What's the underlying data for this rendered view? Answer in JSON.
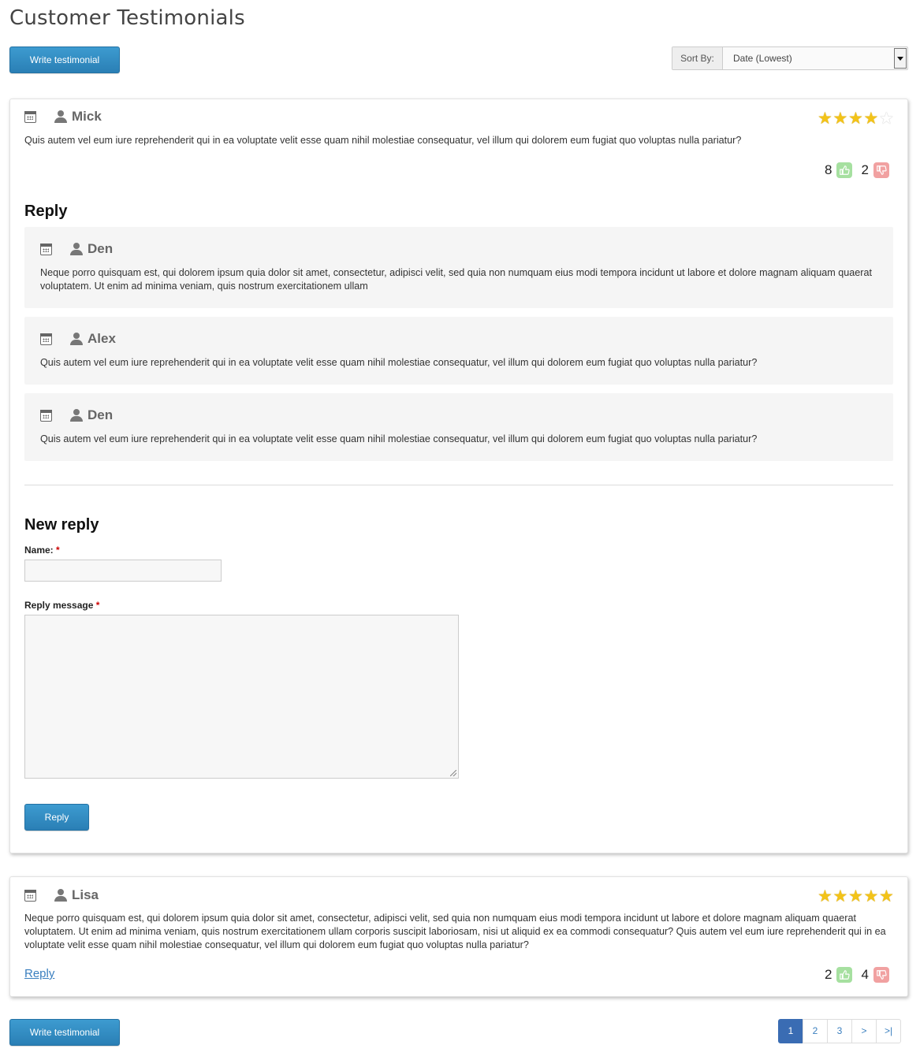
{
  "page": {
    "title": "Customer Testimonials"
  },
  "toolbar": {
    "write_label": "Write testimonial",
    "sort_label": "Sort By:",
    "sort_value": "Date (Lowest)"
  },
  "testimonials": [
    {
      "author": "Mick",
      "rating": 4,
      "text": "Quis autem vel eum iure reprehenderit qui in ea voluptate velit esse quam nihil molestiae consequatur, vel illum qui dolorem eum fugiat quo voluptas nulla pariatur?",
      "likes": "8",
      "dislikes": "2",
      "reply_heading": "Reply",
      "replies": [
        {
          "author": "Den",
          "text": "Neque porro quisquam est, qui dolorem ipsum quia dolor sit amet, consectetur, adipisci velit, sed quia non numquam eius modi tempora incidunt ut labore et dolore magnam aliquam quaerat voluptatem. Ut enim ad minima veniam, quis nostrum exercitationem ullam"
        },
        {
          "author": "Alex",
          "text": "Quis autem vel eum iure reprehenderit qui in ea voluptate velit esse quam nihil molestiae consequatur, vel illum qui dolorem eum fugiat quo voluptas nulla pariatur?"
        },
        {
          "author": "Den",
          "text": "Quis autem vel eum iure reprehenderit qui in ea voluptate velit esse quam nihil molestiae consequatur, vel illum qui dolorem eum fugiat quo voluptas nulla pariatur?"
        }
      ],
      "new_reply": {
        "heading": "New reply",
        "name_label": "Name:",
        "message_label": "Reply message",
        "required_mark": "*",
        "name_value": "",
        "message_value": "",
        "submit_label": "Reply"
      }
    },
    {
      "author": "Lisa",
      "rating": 5,
      "text": "Neque porro quisquam est, qui dolorem ipsum quia dolor sit amet, consectetur, adipisci velit, sed quia non numquam eius modi tempora incidunt ut labore et dolore magnam aliquam quaerat voluptatem. Ut enim ad minima veniam, quis nostrum exercitationem ullam corporis suscipit laboriosam, nisi ut aliquid ex ea commodi consequatur? Quis autem vel eum iure reprehenderit qui in ea voluptate velit esse quam nihil molestiae consequatur, vel illum qui dolorem eum fugiat quo voluptas nulla pariatur?",
      "reply_link": "Reply",
      "likes": "2",
      "dislikes": "4"
    }
  ],
  "icons": {
    "calendar": "calendar-icon",
    "user": "user-icon",
    "thumb_up": "thumbs-up-icon",
    "thumb_down": "thumbs-down-icon",
    "star": "star-icon"
  },
  "colors": {
    "primary_button": "#2a7fb5",
    "star": "#f3c318",
    "thumb_up": "#a6e0a0",
    "thumb_down": "#f1a1a1",
    "pager_active": "#3a6cb3",
    "link": "#3a7fbf"
  },
  "pagination": {
    "current": "1",
    "pages": [
      "1",
      "2",
      "3"
    ],
    "next": ">",
    "last": ">|"
  }
}
